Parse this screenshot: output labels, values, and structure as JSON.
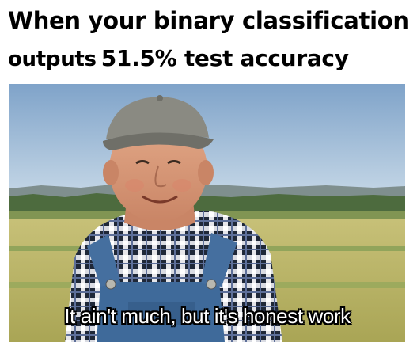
{
  "caption": {
    "line1": "When your binary classification",
    "line2_part1": "outputs",
    "line2_part2": "51.5% test accuracy"
  },
  "photo": {
    "subtitle": "It ain't much, but it's honest work"
  },
  "colors": {
    "sky_top": "#7fa3c9",
    "sky_bottom": "#c3d6e6",
    "field": "#b9b566",
    "tree_line": "#4d6b3e",
    "cap": "#8a8a82",
    "overalls": "#3f6a9a",
    "shirt_dark": "#1c2230",
    "skin": "#d99a78"
  }
}
